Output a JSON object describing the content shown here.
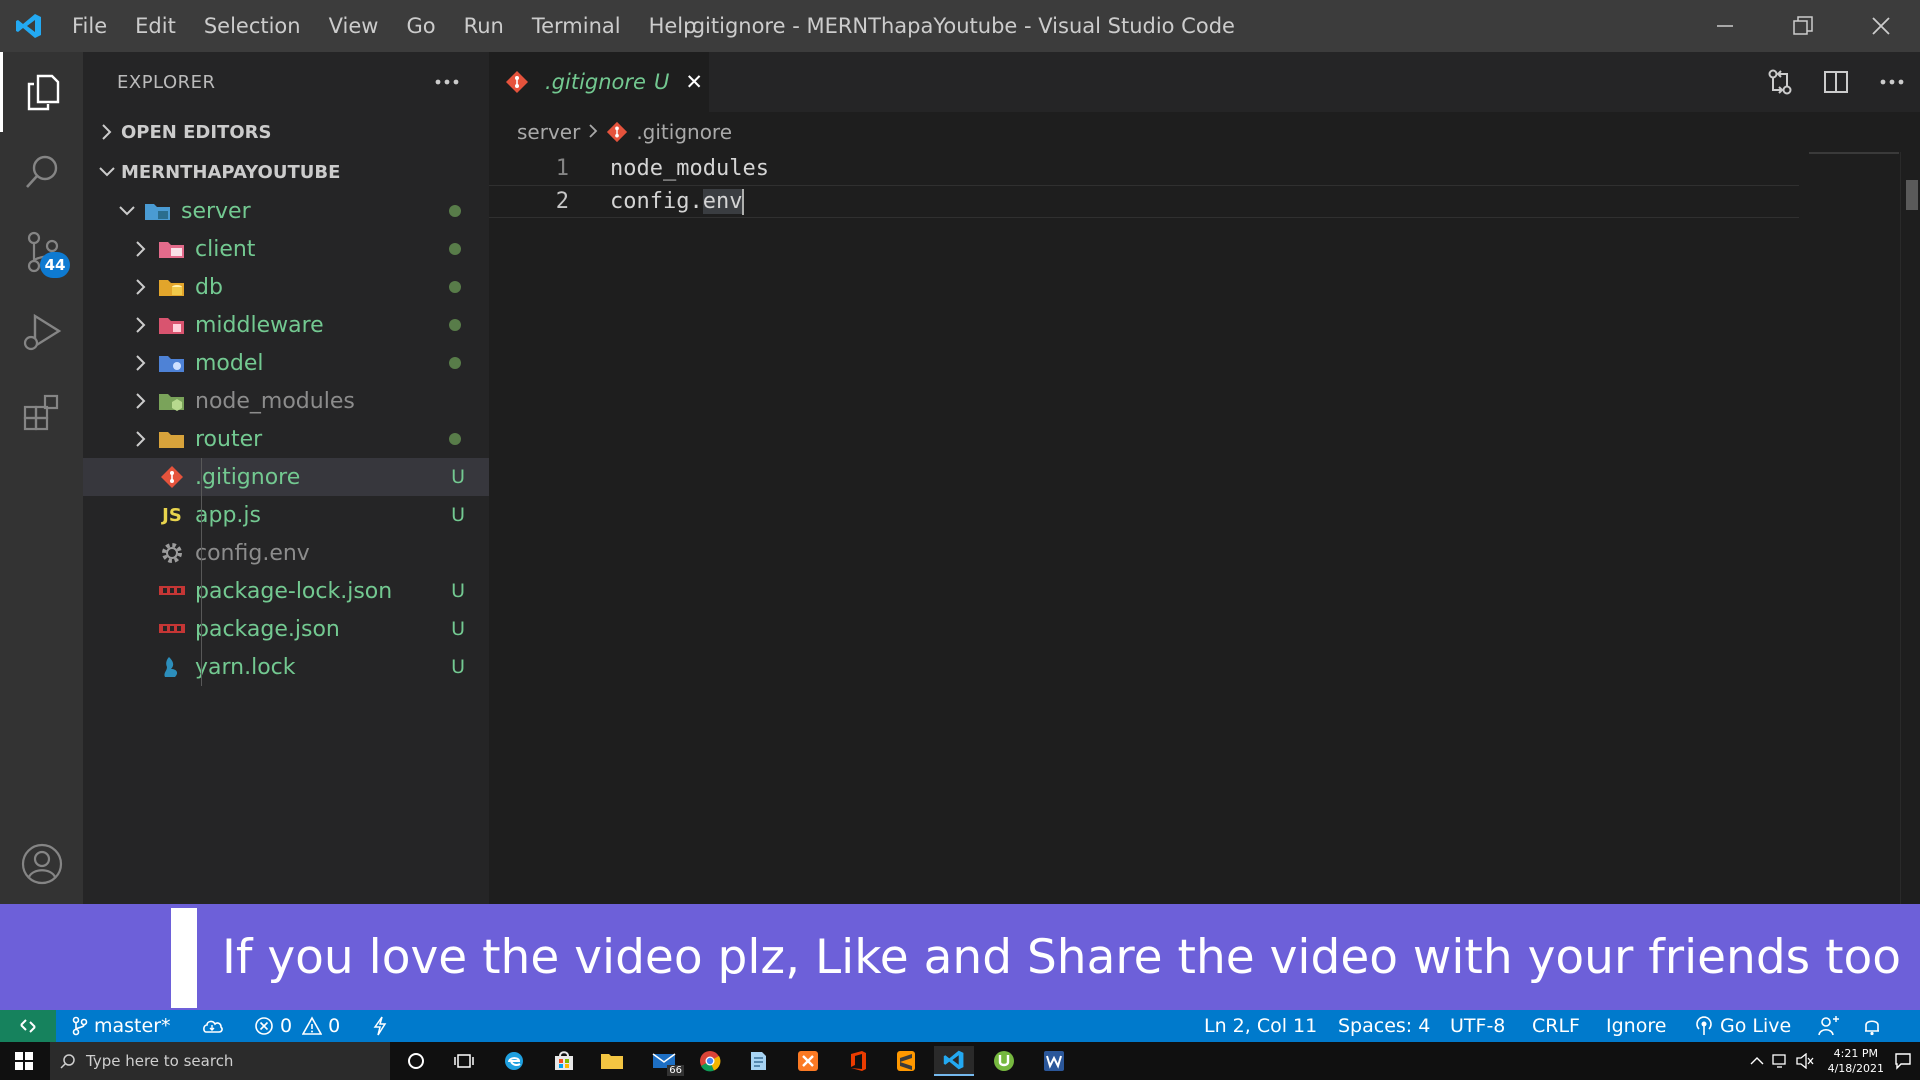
{
  "window": {
    "title": ".gitignore - MERNThapaYoutube - Visual Studio Code",
    "menu": [
      "File",
      "Edit",
      "Selection",
      "View",
      "Go",
      "Run",
      "Terminal",
      "Help"
    ]
  },
  "activity_bar": {
    "items": [
      "explorer-icon",
      "search-icon",
      "source-control-icon",
      "run-debug-icon",
      "extensions-icon",
      "account-icon"
    ],
    "source_control_badge": "44"
  },
  "sidebar": {
    "title": "EXPLORER",
    "open_editors_label": "OPEN EDITORS",
    "project_label": "MERNTHAPAYOUTUBE",
    "tree": [
      {
        "name": "server",
        "type": "folder-open",
        "status": "dot"
      },
      {
        "name": "client",
        "type": "folder",
        "status": "dot"
      },
      {
        "name": "db",
        "type": "folder",
        "status": "dot"
      },
      {
        "name": "middleware",
        "type": "folder",
        "status": "dot"
      },
      {
        "name": "model",
        "type": "folder",
        "status": "dot"
      },
      {
        "name": "node_modules",
        "type": "folder",
        "status": ""
      },
      {
        "name": "router",
        "type": "folder",
        "status": "dot"
      },
      {
        "name": ".gitignore",
        "type": "file",
        "status": "U"
      },
      {
        "name": "app.js",
        "type": "file",
        "status": "U"
      },
      {
        "name": "config.env",
        "type": "file",
        "status": ""
      },
      {
        "name": "package-lock.json",
        "type": "file",
        "status": "U"
      },
      {
        "name": "package.json",
        "type": "file",
        "status": "U"
      },
      {
        "name": "yarn.lock",
        "type": "file",
        "status": "U"
      }
    ]
  },
  "editor": {
    "tab": {
      "label": ".gitignore",
      "status": "U",
      "close": "✕"
    },
    "breadcrumb": [
      "server",
      ".gitignore"
    ],
    "lines": [
      {
        "number": "1",
        "text": "node_modules"
      },
      {
        "number": "2",
        "prefix": "config.",
        "highlight": "env"
      }
    ]
  },
  "banner": {
    "text": "If you love the video plz, Like and Share the video with your friends too :)"
  },
  "status_bar": {
    "branch": "master*",
    "errors": "0",
    "warnings": "0",
    "position": "Ln 2, Col 11",
    "spaces": "Spaces: 4",
    "encoding": "UTF-8",
    "eol": "CRLF",
    "language": "Ignore",
    "go_live": "Go Live"
  },
  "taskbar": {
    "search_placeholder": "Type here to search",
    "mail_badge": "66",
    "time": "4:21 PM",
    "date": "4/18/2021"
  },
  "colors": {
    "untracked": "#73c991",
    "status_bar": "#007acc",
    "banner": "#6d60d9"
  }
}
